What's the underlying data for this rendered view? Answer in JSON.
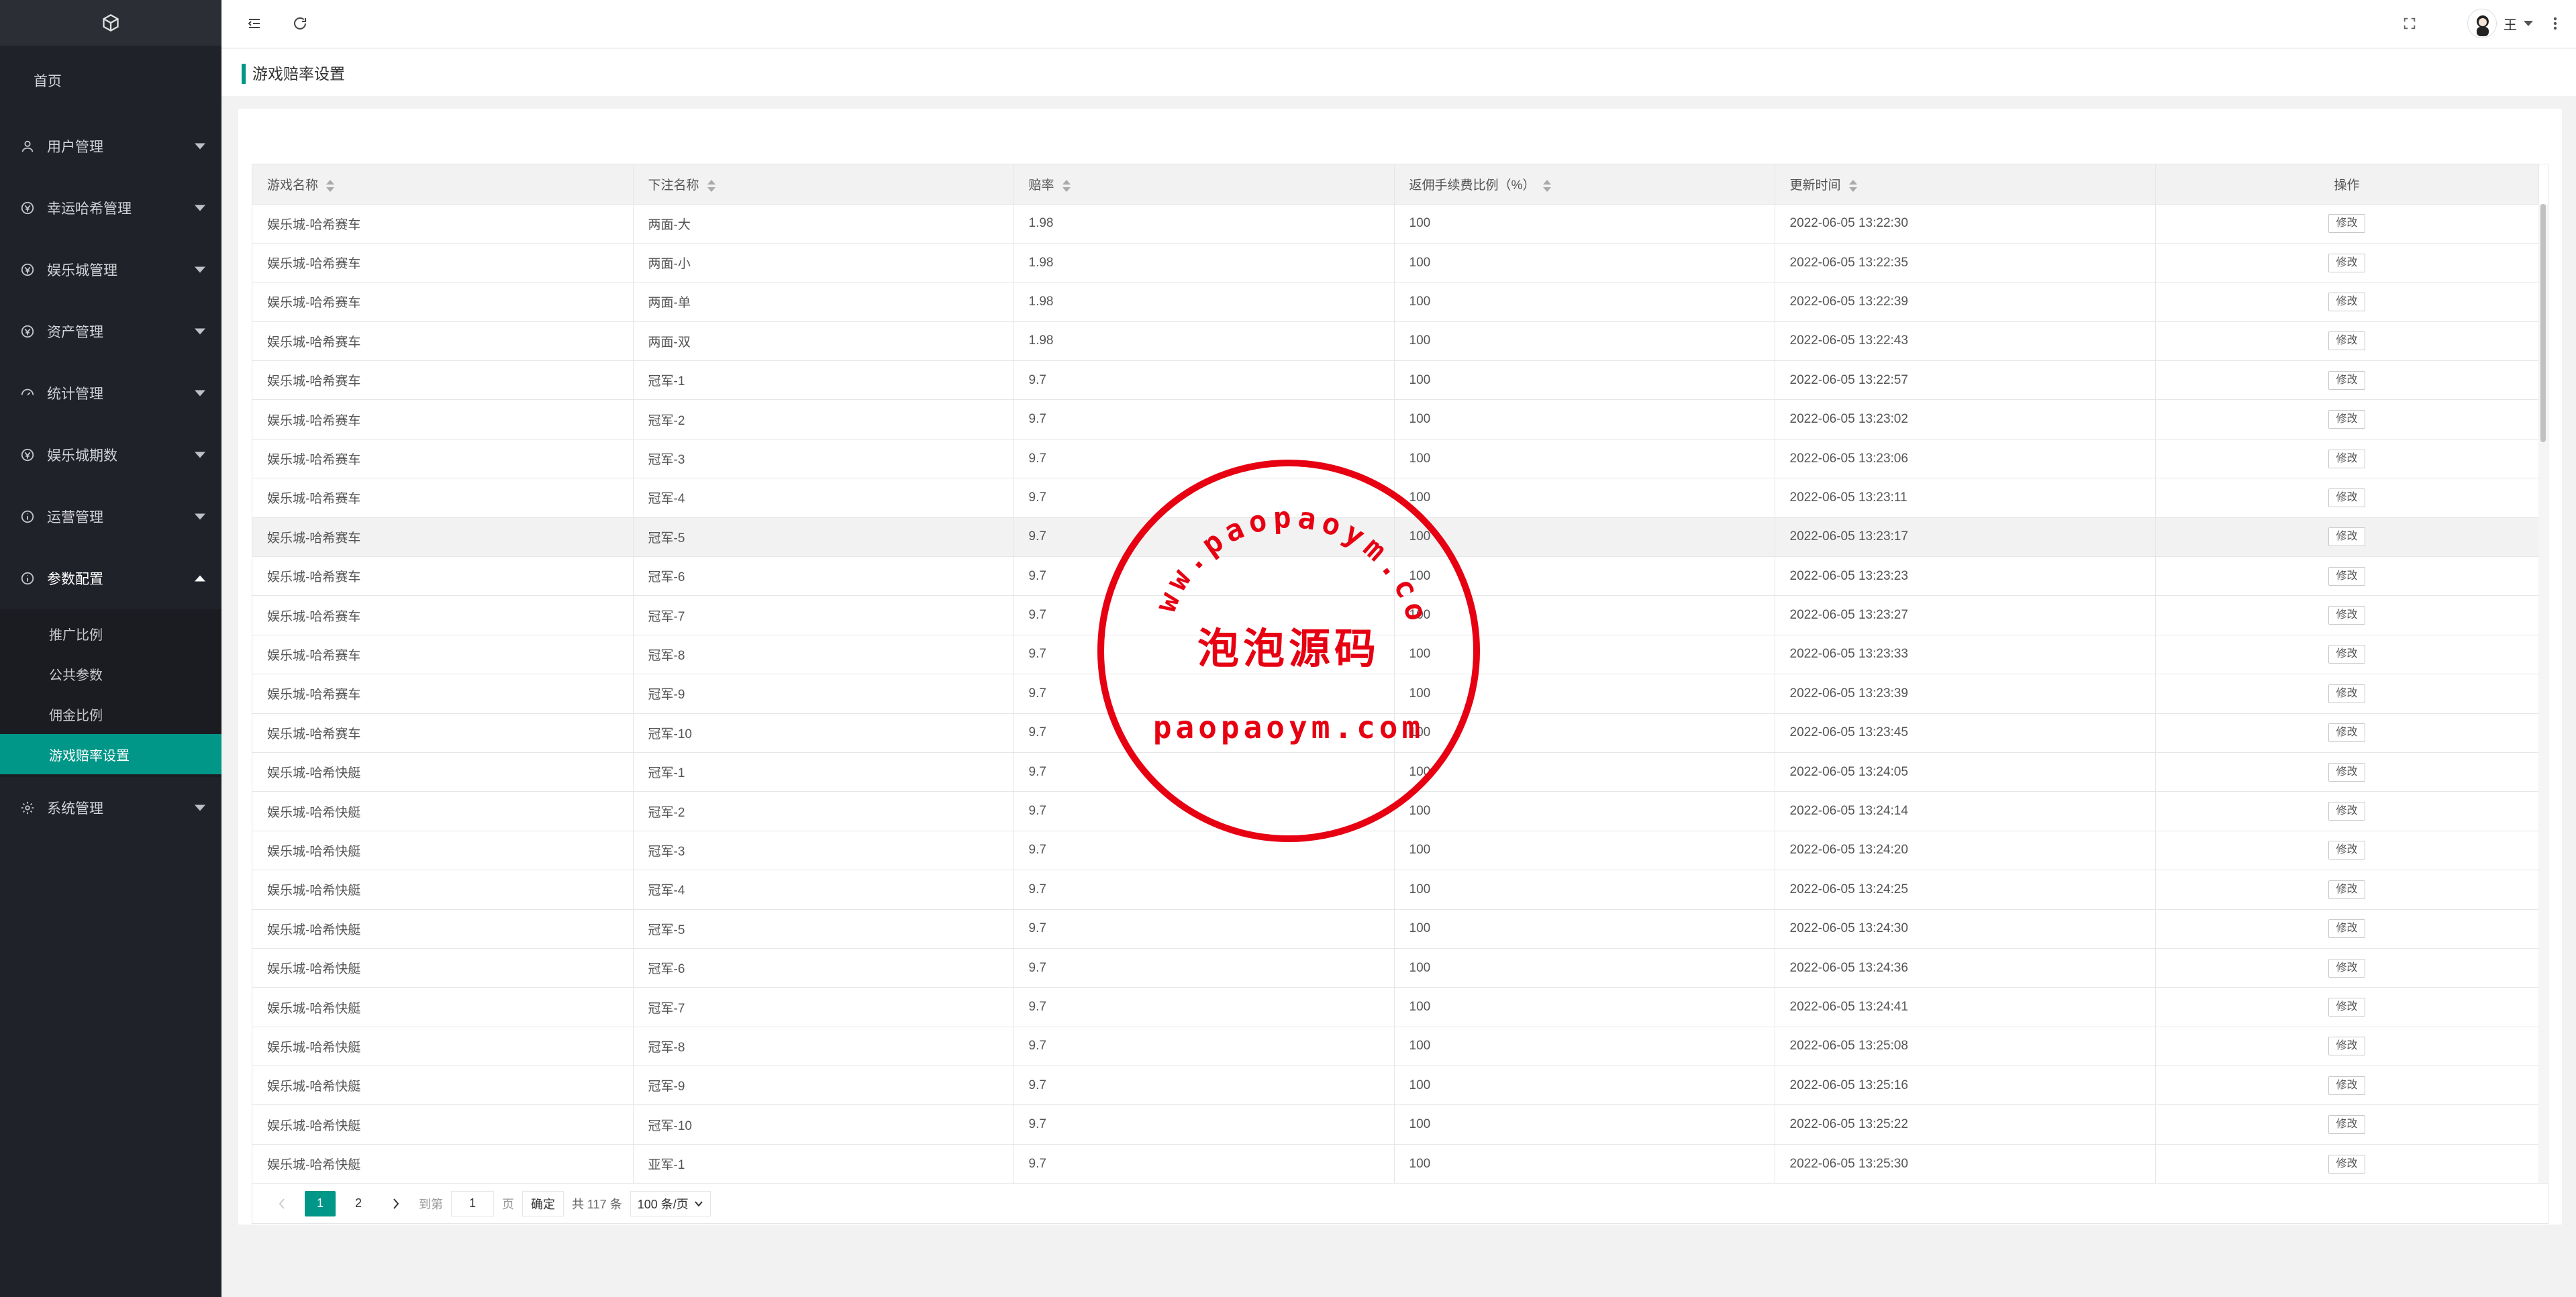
{
  "sidebar": {
    "home": "首页",
    "items": [
      {
        "label": "用户管理",
        "icon": "user-icon"
      },
      {
        "label": "幸运哈希管理",
        "icon": "coin-icon"
      },
      {
        "label": "娱乐城管理",
        "icon": "coin-icon"
      },
      {
        "label": "资产管理",
        "icon": "coin-icon"
      },
      {
        "label": "统计管理",
        "icon": "dashboard-icon"
      },
      {
        "label": "娱乐城期数",
        "icon": "coin-icon"
      },
      {
        "label": "运营管理",
        "icon": "info-icon"
      },
      {
        "label": "参数配置",
        "icon": "info-icon"
      }
    ],
    "submenu": [
      "推广比例",
      "公共参数",
      "佣金比例",
      "游戏赔率设置"
    ],
    "last_item": {
      "label": "系统管理",
      "icon": "gear-icon"
    }
  },
  "header": {
    "user_name": "王"
  },
  "breadcrumb": "游戏赔率设置",
  "table": {
    "columns": [
      "游戏名称",
      "下注名称",
      "赔率",
      "返佣手续费比例（%）",
      "更新时间",
      "操作"
    ],
    "edit_label": "修改",
    "rows": [
      [
        "娱乐城-哈希赛车",
        "两面-大",
        "1.98",
        "100",
        "2022-06-05 13:22:30"
      ],
      [
        "娱乐城-哈希赛车",
        "两面-小",
        "1.98",
        "100",
        "2022-06-05 13:22:35"
      ],
      [
        "娱乐城-哈希赛车",
        "两面-单",
        "1.98",
        "100",
        "2022-06-05 13:22:39"
      ],
      [
        "娱乐城-哈希赛车",
        "两面-双",
        "1.98",
        "100",
        "2022-06-05 13:22:43"
      ],
      [
        "娱乐城-哈希赛车",
        "冠军-1",
        "9.7",
        "100",
        "2022-06-05 13:22:57"
      ],
      [
        "娱乐城-哈希赛车",
        "冠军-2",
        "9.7",
        "100",
        "2022-06-05 13:23:02"
      ],
      [
        "娱乐城-哈希赛车",
        "冠军-3",
        "9.7",
        "100",
        "2022-06-05 13:23:06"
      ],
      [
        "娱乐城-哈希赛车",
        "冠军-4",
        "9.7",
        "100",
        "2022-06-05 13:23:11"
      ],
      [
        "娱乐城-哈希赛车",
        "冠军-5",
        "9.7",
        "100",
        "2022-06-05 13:23:17"
      ],
      [
        "娱乐城-哈希赛车",
        "冠军-6",
        "9.7",
        "100",
        "2022-06-05 13:23:23"
      ],
      [
        "娱乐城-哈希赛车",
        "冠军-7",
        "9.7",
        "100",
        "2022-06-05 13:23:27"
      ],
      [
        "娱乐城-哈希赛车",
        "冠军-8",
        "9.7",
        "100",
        "2022-06-05 13:23:33"
      ],
      [
        "娱乐城-哈希赛车",
        "冠军-9",
        "9.7",
        "100",
        "2022-06-05 13:23:39"
      ],
      [
        "娱乐城-哈希赛车",
        "冠军-10",
        "9.7",
        "100",
        "2022-06-05 13:23:45"
      ],
      [
        "娱乐城-哈希快艇",
        "冠军-1",
        "9.7",
        "100",
        "2022-06-05 13:24:05"
      ],
      [
        "娱乐城-哈希快艇",
        "冠军-2",
        "9.7",
        "100",
        "2022-06-05 13:24:14"
      ],
      [
        "娱乐城-哈希快艇",
        "冠军-3",
        "9.7",
        "100",
        "2022-06-05 13:24:20"
      ],
      [
        "娱乐城-哈希快艇",
        "冠军-4",
        "9.7",
        "100",
        "2022-06-05 13:24:25"
      ],
      [
        "娱乐城-哈希快艇",
        "冠军-5",
        "9.7",
        "100",
        "2022-06-05 13:24:30"
      ],
      [
        "娱乐城-哈希快艇",
        "冠军-6",
        "9.7",
        "100",
        "2022-06-05 13:24:36"
      ],
      [
        "娱乐城-哈希快艇",
        "冠军-7",
        "9.7",
        "100",
        "2022-06-05 13:24:41"
      ],
      [
        "娱乐城-哈希快艇",
        "冠军-8",
        "9.7",
        "100",
        "2022-06-05 13:25:08"
      ],
      [
        "娱乐城-哈希快艇",
        "冠军-9",
        "9.7",
        "100",
        "2022-06-05 13:25:16"
      ],
      [
        "娱乐城-哈希快艇",
        "冠军-10",
        "9.7",
        "100",
        "2022-06-05 13:25:22"
      ],
      [
        "娱乐城-哈希快艇",
        "亚军-1",
        "9.7",
        "100",
        "2022-06-05 13:25:30"
      ]
    ]
  },
  "pagination": {
    "pages": [
      "1",
      "2"
    ],
    "goto_label": "到第",
    "goto_value": "1",
    "page_unit": "页",
    "confirm": "确定",
    "total": "共 117 条",
    "page_size": "100 条/页"
  },
  "watermark": {
    "arc_text": "www.paopaoym.com",
    "center_text": "泡泡源码",
    "bottom_text": "paopaoym.com"
  },
  "colors": {
    "accent": "#009688",
    "sidebar": "#20222a",
    "seal": "#e60012"
  }
}
